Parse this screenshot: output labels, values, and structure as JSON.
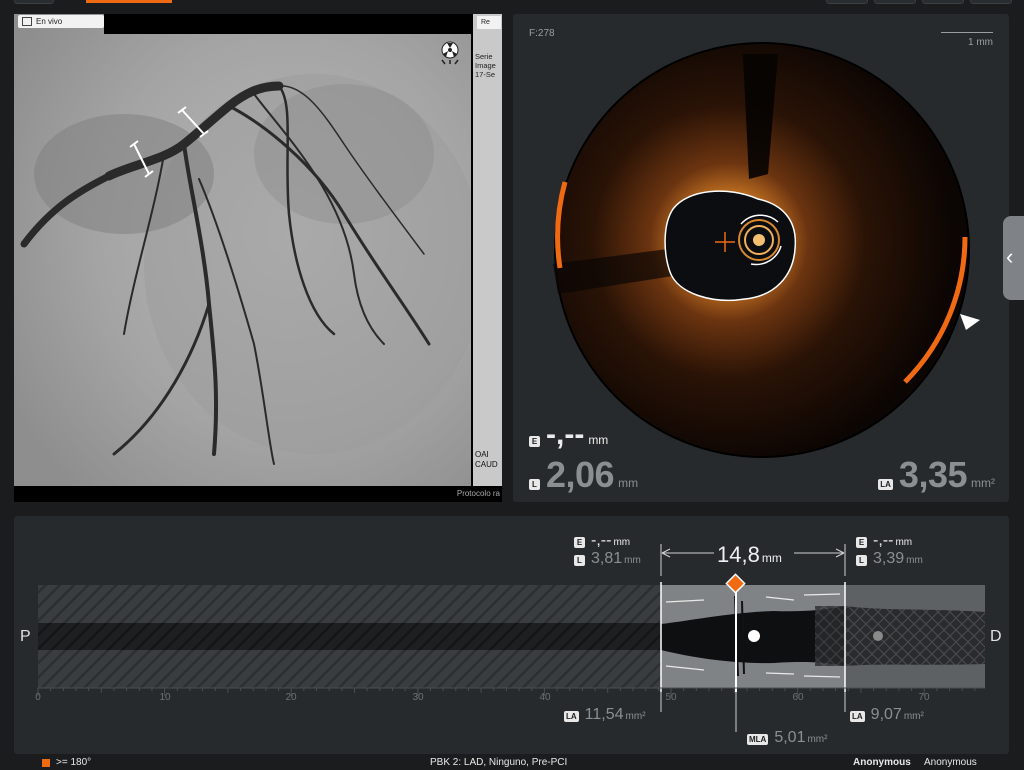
{
  "angio": {
    "tag_label": "En vivo",
    "side_button": "Re",
    "side_text": "Serie\nImage\n17-Se",
    "orientation": "OAI\nCAUD",
    "protocol": "Protocolo ra"
  },
  "oct": {
    "frame": "F:278",
    "scale_label": "1 mm",
    "e_badge": "E",
    "e_value": "-,--",
    "e_unit": "mm",
    "l_badge": "L",
    "l_value": "2,06",
    "l_unit": "mm",
    "la_badge": "LA",
    "la_value": "3,35",
    "la_unit": "mm²"
  },
  "longitudinal": {
    "p_label": "P",
    "d_label": "D",
    "prox": {
      "e_badge": "E",
      "e_value": "-,--",
      "e_unit": "mm",
      "l_badge": "L",
      "l_value": "3,81",
      "l_unit": "mm",
      "la_badge": "LA",
      "la_value": "11,54",
      "la_unit": "mm²"
    },
    "dist": {
      "e_badge": "E",
      "e_value": "-,--",
      "e_unit": "mm",
      "l_badge": "L",
      "l_value": "3,39",
      "l_unit": "mm",
      "la_badge": "LA",
      "la_value": "9,07",
      "la_unit": "mm²"
    },
    "length_value": "14,8",
    "length_unit": "mm",
    "mla_badge": "MLA",
    "mla_value": "5,01",
    "mla_unit": "mm²",
    "axis_ticks": [
      "0",
      "10",
      "20",
      "30",
      "40",
      "50",
      "60",
      "70"
    ]
  },
  "footer": {
    "legend": ">= 180°",
    "pullback": "PBK 2:  LAD,  Ninguno,  Pre-PCI",
    "patient_bold": "Anonymous",
    "patient": "Anonymous"
  },
  "colors": {
    "accent": "#f06a14",
    "panel": "#272a2d",
    "background": "#1a1c1e"
  }
}
